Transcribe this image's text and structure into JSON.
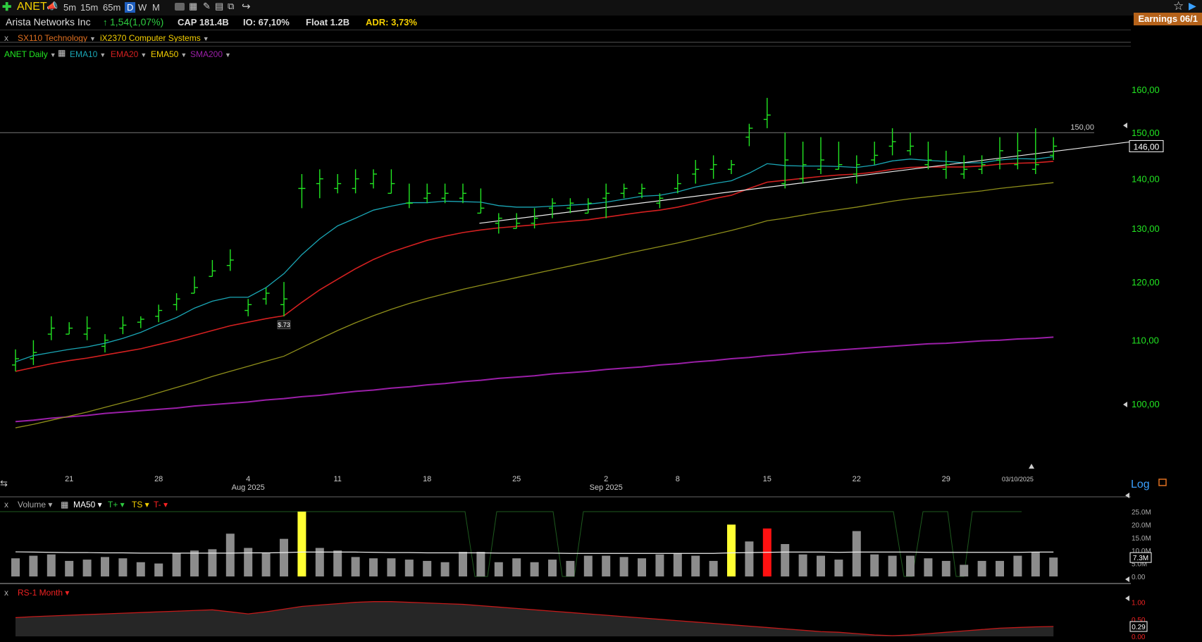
{
  "toolbar": {
    "ticker": "ANET",
    "timeframes": [
      "5m",
      "15m",
      "65m",
      "D",
      "W",
      "M"
    ],
    "active_timeframe": "D"
  },
  "info": {
    "company": "Arista Networks Inc",
    "change": "1,54(1,07%)",
    "cap": "CAP 181.4B",
    "io": "IO: 67,10%",
    "float": "Float 1.2B",
    "adr": "ADR: 3,73%",
    "earnings": "Earnings 06/1"
  },
  "sector": {
    "close": "x",
    "sector": "SX110 Technology",
    "industry": "iX2370 Computer Systems"
  },
  "legend": {
    "symbol": "ANET Daily",
    "ema10": "EMA10",
    "ema20": "EMA20",
    "ema50": "EMA50",
    "sma200": "SMA200"
  },
  "colors": {
    "up_bar": "#22e622",
    "ema10": "#1aa6b5",
    "ema20": "#d42020",
    "ema50": "#8f8f1a",
    "sma200": "#9b1fa8",
    "axis_text": "#22e622",
    "volume_bar": "#8c8c8c",
    "volume_high": "#ffff33",
    "volume_red": "#ff1111",
    "rs_line": "#c21a1a"
  },
  "chart_data": [
    {
      "type": "ohlc",
      "title": "ANET Daily",
      "scale": "log",
      "ylim": [
        96,
        166
      ],
      "y_ticks": [
        "160,00",
        "150,00",
        "140,00",
        "130,00",
        "120,00",
        "110,00",
        "100,00"
      ],
      "last_price_label": "146,00",
      "horizontal_line": {
        "value": 150,
        "label": "150,00"
      },
      "x_labels": [
        {
          "day": "21",
          "month": ""
        },
        {
          "day": "28",
          "month": ""
        },
        {
          "day": "4",
          "month": "Aug 2025"
        },
        {
          "day": "11",
          "month": ""
        },
        {
          "day": "18",
          "month": ""
        },
        {
          "day": "25",
          "month": ""
        },
        {
          "day": "2",
          "month": "Sep 2025"
        },
        {
          "day": "8",
          "month": ""
        },
        {
          "day": "15",
          "month": ""
        },
        {
          "day": "22",
          "month": ""
        },
        {
          "day": "29",
          "month": ""
        },
        {
          "day": "03/10/2025",
          "month": ""
        }
      ],
      "annotation": "$.73",
      "scale_label": "Log",
      "bars": [
        [
          107,
          106,
          108.5,
          105
        ],
        [
          108,
          107,
          110,
          106
        ],
        [
          112,
          111,
          114,
          110
        ],
        [
          112,
          111,
          113,
          111
        ],
        [
          112,
          111,
          114,
          110
        ],
        [
          110,
          109,
          111,
          108
        ],
        [
          112.5,
          112,
          114,
          111
        ],
        [
          113.5,
          113,
          114,
          112
        ],
        [
          115,
          114,
          116,
          113
        ],
        [
          117,
          116,
          118,
          115
        ],
        [
          119,
          118,
          121,
          118
        ],
        [
          122,
          121,
          124,
          121
        ],
        [
          124,
          123,
          126,
          122
        ],
        [
          116,
          115,
          117,
          114
        ],
        [
          118,
          117,
          119,
          116
        ],
        [
          117,
          116,
          120,
          114
        ],
        [
          138,
          138,
          141,
          134
        ],
        [
          140,
          139,
          142,
          136
        ],
        [
          139,
          138,
          141,
          137
        ],
        [
          140,
          138,
          142,
          137
        ],
        [
          141,
          139,
          142,
          138
        ],
        [
          139,
          137,
          142,
          137
        ],
        [
          135,
          135,
          139,
          134
        ],
        [
          137,
          136,
          139,
          135
        ],
        [
          137,
          136,
          139,
          135
        ],
        [
          137,
          136,
          139,
          135
        ],
        [
          134,
          133,
          138,
          133
        ],
        [
          132,
          131,
          133,
          129
        ],
        [
          131,
          130,
          133,
          130
        ],
        [
          132,
          131,
          134,
          130
        ],
        [
          135,
          134,
          136,
          132
        ],
        [
          135,
          134,
          136,
          133
        ],
        [
          135,
          133,
          136,
          133
        ],
        [
          137,
          136,
          139,
          132
        ],
        [
          138,
          137,
          139,
          136
        ],
        [
          138,
          137,
          139,
          136
        ],
        [
          136,
          135,
          137,
          134
        ],
        [
          139,
          138,
          141,
          137
        ],
        [
          142,
          141,
          144,
          139
        ],
        [
          143,
          142,
          145,
          140
        ],
        [
          143,
          142,
          144,
          141
        ],
        [
          151,
          149,
          152,
          147
        ],
        [
          154,
          153,
          158,
          151
        ],
        [
          144,
          139,
          150,
          138
        ],
        [
          143,
          140,
          148,
          139
        ],
        [
          144,
          142,
          149,
          141
        ],
        [
          143,
          142,
          148,
          142
        ],
        [
          143,
          141,
          145,
          139
        ],
        [
          145,
          144,
          148,
          143
        ],
        [
          148,
          147,
          151,
          145
        ],
        [
          147,
          146,
          150,
          145
        ],
        [
          144,
          143,
          148,
          142
        ],
        [
          143,
          142,
          146,
          140
        ],
        [
          142,
          141,
          145,
          140
        ],
        [
          143,
          142,
          145,
          141
        ],
        [
          146,
          144,
          149,
          142
        ],
        [
          146,
          143,
          150,
          142
        ],
        [
          143,
          142,
          151,
          141
        ],
        [
          147,
          145,
          149,
          144
        ]
      ],
      "ema10": [
        106.5,
        107.5,
        108,
        108.5,
        108.9,
        109.5,
        110.3,
        111.3,
        112.6,
        113.8,
        115.4,
        116.6,
        117.3,
        117.3,
        119,
        121.5,
        125,
        128,
        130.5,
        132,
        133.6,
        134.4,
        135.1,
        135.1,
        135.4,
        135.3,
        135.2,
        134.5,
        134.2,
        134.2,
        134.4,
        134.6,
        134.8,
        135.2,
        135.8,
        136.4,
        136.6,
        137.3,
        138.3,
        139,
        139.6,
        141.2,
        143.2,
        142.8,
        142.7,
        142.7,
        142.6,
        142.4,
        142.9,
        143.8,
        144.2,
        143.9,
        143.7,
        143.4,
        143.4,
        144,
        144.3,
        144.2,
        144.7
      ],
      "ema20": [
        105,
        105.6,
        106.2,
        106.7,
        107.1,
        107.6,
        108.1,
        108.6,
        109.3,
        110,
        110.8,
        111.6,
        112.4,
        113,
        113.6,
        114.1,
        116.4,
        118.6,
        120.5,
        122.4,
        124.1,
        125.5,
        126.6,
        127.7,
        128.5,
        129.2,
        129.7,
        130.1,
        130.4,
        130.7,
        131.1,
        131.4,
        131.7,
        132.2,
        132.7,
        133.2,
        133.6,
        134.2,
        135,
        135.9,
        136.6,
        138,
        139.3,
        139.7,
        140.1,
        140.5,
        140.8,
        141,
        141.4,
        142,
        142.4,
        142.5,
        142.5,
        142.5,
        142.7,
        143.1,
        143.3,
        143.4,
        143.7
      ],
      "ema50": [
        96.5,
        97,
        97.6,
        98.2,
        98.8,
        99.5,
        100.2,
        100.9,
        101.7,
        102.5,
        103.3,
        104.2,
        105,
        105.8,
        106.6,
        107.4,
        108.8,
        110.2,
        111.6,
        112.9,
        114.1,
        115.2,
        116.2,
        117.1,
        117.9,
        118.7,
        119.4,
        120.1,
        120.8,
        121.5,
        122.2,
        122.9,
        123.6,
        124.3,
        125.1,
        125.8,
        126.5,
        127.2,
        128,
        128.8,
        129.6,
        130.5,
        131.5,
        132,
        132.6,
        133.2,
        133.7,
        134.2,
        134.8,
        135.4,
        135.9,
        136.3,
        136.7,
        137.1,
        137.5,
        138,
        138.4,
        138.8,
        139.2
      ],
      "sma200": [
        97.4,
        97.6,
        97.9,
        98.1,
        98.3,
        98.6,
        98.8,
        99,
        99.2,
        99.4,
        99.7,
        99.9,
        100.1,
        100.3,
        100.6,
        100.8,
        101.1,
        101.3,
        101.6,
        101.9,
        102.1,
        102.4,
        102.6,
        102.9,
        103.1,
        103.4,
        103.6,
        103.9,
        104.1,
        104.3,
        104.6,
        104.8,
        105,
        105.3,
        105.5,
        105.7,
        106,
        106.2,
        106.5,
        106.7,
        107,
        107.2,
        107.5,
        107.7,
        108,
        108.2,
        108.4,
        108.6,
        108.8,
        109,
        109.2,
        109.4,
        109.5,
        109.7,
        109.9,
        110,
        110.2,
        110.3,
        110.5
      ],
      "trendline": {
        "start_index": 26,
        "start_value": 131,
        "end_value": 145.5
      }
    },
    {
      "type": "bar",
      "title": "Volume",
      "indicator_labels": [
        "MA50",
        "T+",
        "TS",
        "T-"
      ],
      "y_ticks": [
        "25.0M",
        "20.0M",
        "15.0M",
        "10.0M",
        "5.0M",
        "0.00"
      ],
      "last_value_label": "7.3M",
      "ylim": [
        0,
        25
      ],
      "values": [
        7,
        8,
        8.5,
        6,
        6.5,
        7.5,
        7,
        5.5,
        5,
        9,
        10,
        10.5,
        16.5,
        11,
        9,
        14.5,
        25,
        11,
        10,
        7.5,
        7,
        7,
        6.5,
        6,
        5.5,
        9.5,
        9.5,
        5.5,
        7,
        5.5,
        6.5,
        6,
        8,
        8,
        7.5,
        7,
        8.5,
        9,
        8,
        6,
        20,
        13.5,
        18.5,
        12.5,
        8.5,
        8,
        6.5,
        17.5,
        8.5,
        8,
        8,
        7,
        6,
        4.5,
        6,
        6,
        8,
        9.5,
        7.3
      ],
      "kinds": [
        "n",
        "n",
        "n",
        "n",
        "n",
        "n",
        "n",
        "n",
        "n",
        "n",
        "n",
        "n",
        "n",
        "n",
        "n",
        "n",
        "y",
        "n",
        "n",
        "n",
        "n",
        "n",
        "n",
        "n",
        "n",
        "n",
        "n",
        "n",
        "n",
        "n",
        "n",
        "n",
        "n",
        "n",
        "n",
        "n",
        "n",
        "n",
        "n",
        "n",
        "y",
        "n",
        "r",
        "n",
        "n",
        "n",
        "n",
        "n",
        "n",
        "n",
        "n",
        "n",
        "n",
        "n",
        "n",
        "n",
        "n",
        "n",
        "n"
      ],
      "ma50": [
        9.5,
        9.4,
        9.3,
        9.2,
        9.2,
        9.1,
        9.1,
        9,
        9,
        9,
        9,
        9,
        9,
        9.1,
        9.1,
        9.2,
        9.4,
        9.4,
        9.4,
        9.4,
        9.3,
        9.2,
        9.2,
        9.1,
        9.1,
        9.1,
        9.1,
        9,
        9,
        9,
        9,
        8.9,
        8.9,
        8.9,
        8.9,
        8.9,
        8.9,
        8.9,
        8.9,
        8.9,
        9.1,
        9.2,
        9.3,
        9.4,
        9.4,
        9.4,
        9.3,
        9.4,
        9.4,
        9.4,
        9.4,
        9.3,
        9.3,
        9.3,
        9.3,
        9.3,
        9.3,
        9.4,
        9.4
      ]
    },
    {
      "type": "area",
      "title": "RS-1 Month",
      "y_ticks": [
        "1.00",
        "0.50",
        "0.00"
      ],
      "last_value_label": "0.29",
      "ylim": [
        0,
        1.2
      ],
      "values": [
        0.55,
        0.58,
        0.6,
        0.62,
        0.64,
        0.66,
        0.68,
        0.7,
        0.72,
        0.74,
        0.76,
        0.78,
        0.72,
        0.66,
        0.72,
        0.8,
        0.88,
        0.92,
        0.96,
        1,
        1.02,
        1.02,
        1,
        0.98,
        0.96,
        0.94,
        0.9,
        0.86,
        0.82,
        0.78,
        0.74,
        0.7,
        0.66,
        0.62,
        0.58,
        0.54,
        0.5,
        0.46,
        0.42,
        0.38,
        0.34,
        0.3,
        0.26,
        0.22,
        0.18,
        0.14,
        0.12,
        0.08,
        0.04,
        0.02,
        0.04,
        0.08,
        0.12,
        0.16,
        0.2,
        0.24,
        0.26,
        0.28,
        0.29
      ]
    }
  ]
}
